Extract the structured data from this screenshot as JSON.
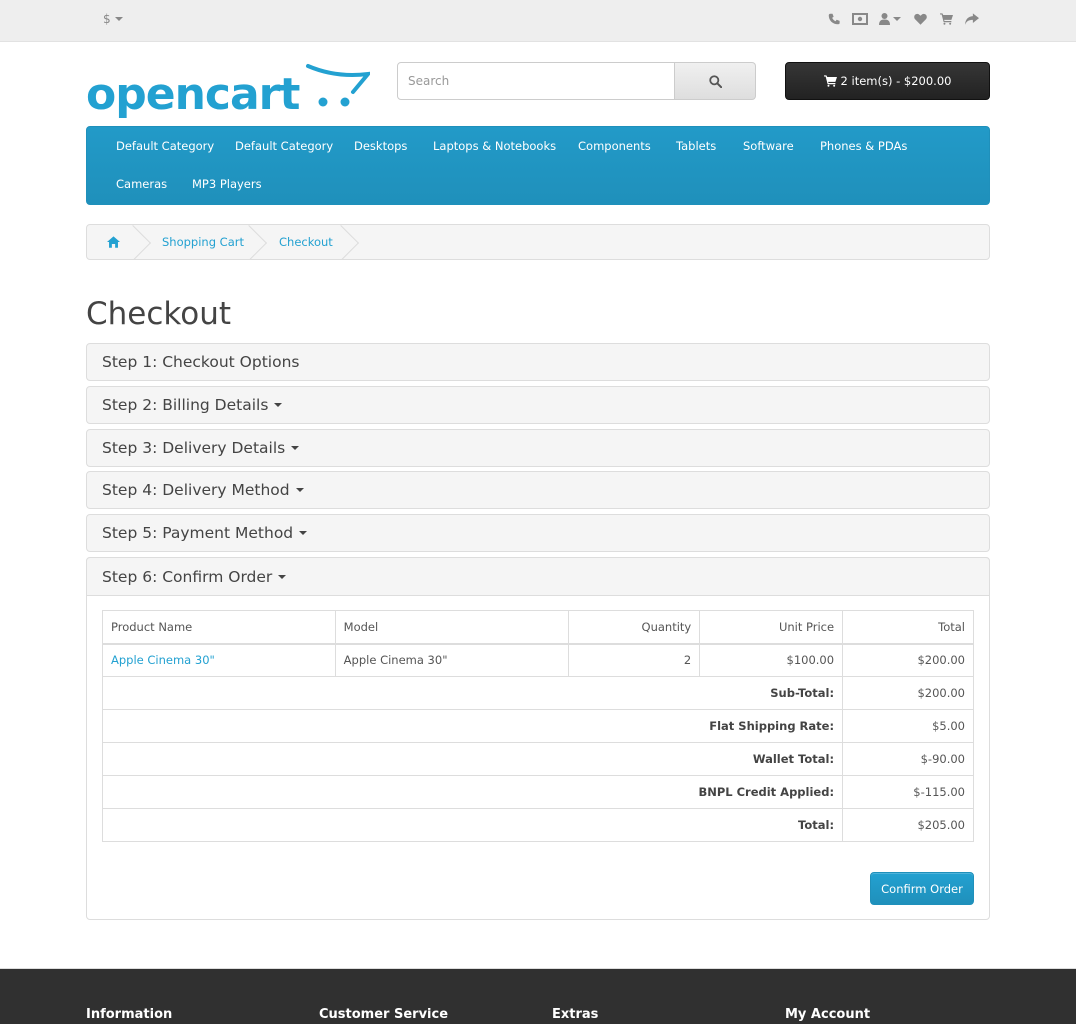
{
  "topbar": {
    "currency_symbol": "$",
    "icons": [
      "phone-icon",
      "money-icon",
      "user-icon",
      "heart-icon",
      "cart-icon",
      "share-icon"
    ]
  },
  "header": {
    "logo_text": "opencart",
    "search_placeholder": "Search",
    "cart_label": "2 item(s) - $200.00"
  },
  "menu": {
    "items": [
      "Default Category",
      "Default Category",
      "Desktops",
      "Laptops & Notebooks",
      "Components",
      "Tablets",
      "Software",
      "Phones & PDAs",
      "Cameras",
      "MP3 Players"
    ]
  },
  "breadcrumb": {
    "items": [
      "Shopping Cart",
      "Checkout"
    ]
  },
  "page": {
    "title": "Checkout"
  },
  "steps": [
    "Step 1: Checkout Options",
    "Step 2: Billing Details",
    "Step 3: Delivery Details",
    "Step 4: Delivery Method",
    "Step 5: Payment Method",
    "Step 6: Confirm Order"
  ],
  "order_table": {
    "headers": [
      "Product Name",
      "Model",
      "Quantity",
      "Unit Price",
      "Total"
    ],
    "rows": [
      {
        "name": "Apple Cinema 30\"",
        "model": "Apple Cinema 30\"",
        "quantity": "2",
        "unit_price": "$100.00",
        "total": "$200.00"
      }
    ],
    "totals": [
      {
        "label": "Sub-Total:",
        "value": "$200.00"
      },
      {
        "label": "Flat Shipping Rate:",
        "value": "$5.00"
      },
      {
        "label": "Wallet Total:",
        "value": "$-90.00"
      },
      {
        "label": "BNPL Credit Applied:",
        "value": "$-115.00"
      },
      {
        "label": "Total:",
        "value": "$205.00"
      }
    ]
  },
  "confirm_button_label": "Confirm Order",
  "footer": {
    "headings": [
      "Information",
      "Customer Service",
      "Extras",
      "My Account"
    ]
  },
  "colors": {
    "brand_blue": "#229ac8",
    "link": "#23a1d1",
    "dark": "#303030"
  }
}
